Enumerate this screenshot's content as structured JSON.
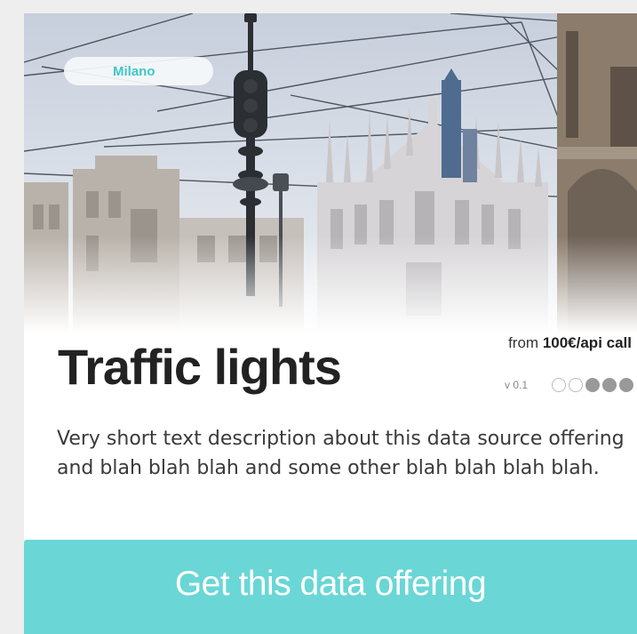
{
  "card": {
    "location_tag": "Milano",
    "title": "Traffic lights",
    "price_prefix": "from",
    "price_value": "100€/api call",
    "version": "v 0.1",
    "rating": {
      "filled": 3,
      "total": 5
    },
    "description": "Very short text description about this data source offering and blah blah blah and some other blah blah blah blah.",
    "cta_label": "Get this data offering"
  },
  "colors": {
    "accent": "#6ad6d6",
    "location_text": "#3fc6c6",
    "title_text": "#222222",
    "rating_filled": "#999999"
  },
  "hero_image": {
    "subject": "milan-cathedral-with-traffic-light-and-tram-wires"
  }
}
